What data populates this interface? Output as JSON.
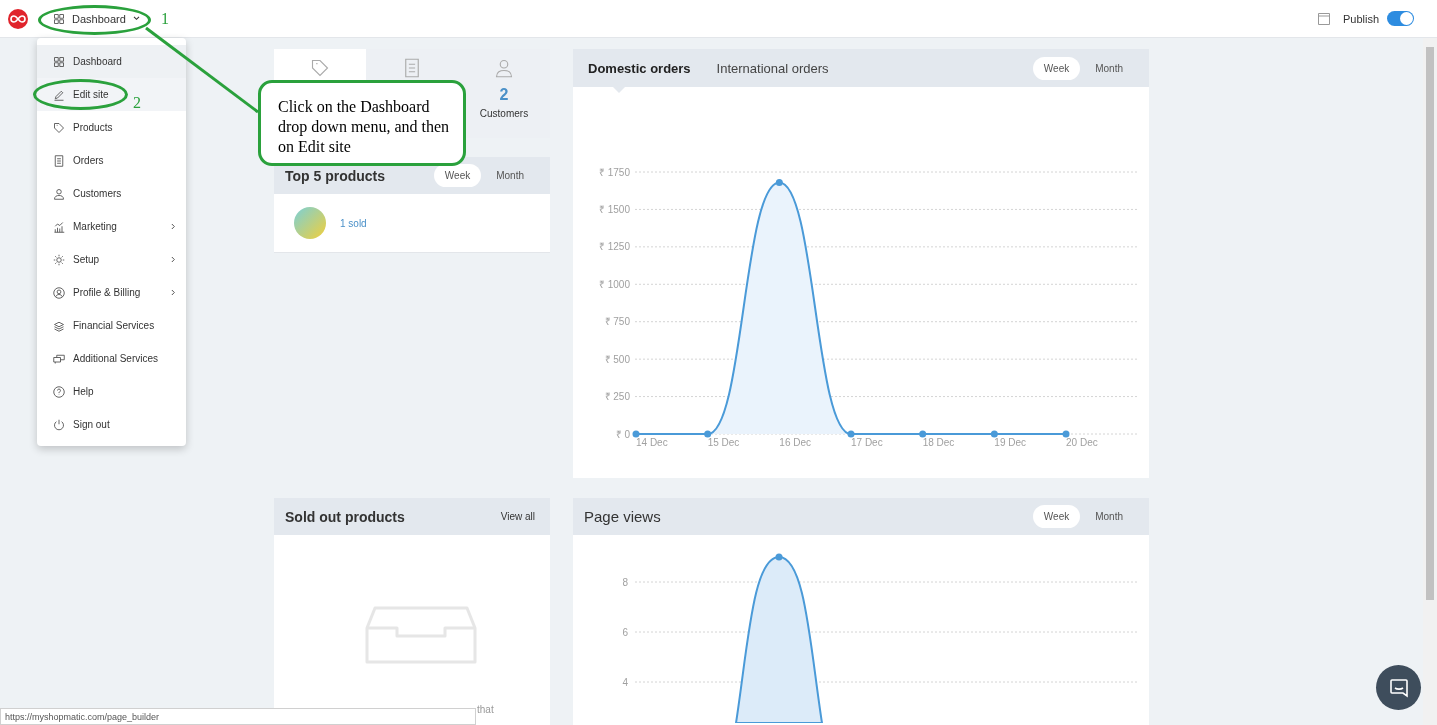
{
  "topbar": {
    "nav_button": {
      "label": "Dashboard",
      "expanded": true
    },
    "publish": {
      "label": "Publish",
      "on": true
    }
  },
  "menu": [
    {
      "label": "Dashboard",
      "kind": "grid",
      "selected": true,
      "hovered": false,
      "submenu": false
    },
    {
      "label": "Edit site",
      "kind": "pencil",
      "selected": false,
      "hovered": true,
      "submenu": false
    },
    {
      "label": "Products",
      "kind": "tag",
      "selected": false,
      "hovered": false,
      "submenu": false
    },
    {
      "label": "Orders",
      "kind": "document",
      "selected": false,
      "hovered": false,
      "submenu": false
    },
    {
      "label": "Customers",
      "kind": "person",
      "selected": false,
      "hovered": false,
      "submenu": false
    },
    {
      "label": "Marketing",
      "kind": "chart",
      "selected": false,
      "hovered": false,
      "submenu": true
    },
    {
      "label": "Setup",
      "kind": "gear",
      "selected": false,
      "hovered": false,
      "submenu": true
    },
    {
      "label": "Profile & Billing",
      "kind": "user-circle",
      "selected": false,
      "hovered": false,
      "submenu": true
    },
    {
      "label": "Financial Services",
      "kind": "stack",
      "selected": false,
      "hovered": false,
      "submenu": false
    },
    {
      "label": "Additional Services",
      "kind": "services",
      "selected": false,
      "hovered": false,
      "submenu": false
    },
    {
      "label": "Help",
      "kind": "question",
      "selected": false,
      "hovered": false,
      "submenu": false
    },
    {
      "label": "Sign out",
      "kind": "power",
      "selected": false,
      "hovered": false,
      "submenu": false
    }
  ],
  "stats": [
    {
      "kind": "tag",
      "selected": true
    },
    {
      "kind": "document",
      "selected": false
    },
    {
      "kind": "person",
      "selected": false,
      "value": "2",
      "label": "Customers"
    }
  ],
  "top_products": {
    "title": "Top 5 products",
    "periods": [
      {
        "label": "Week",
        "selected": true
      },
      {
        "label": "Month",
        "selected": false
      }
    ],
    "rows": [
      {
        "sold": "1 sold"
      }
    ]
  },
  "orders_chart": {
    "tabs": [
      {
        "label": "Domestic orders",
        "selected": true
      },
      {
        "label": "International orders",
        "selected": false
      }
    ],
    "periods": [
      {
        "label": "Week",
        "selected": true
      },
      {
        "label": "Month",
        "selected": false
      }
    ],
    "chart_data": {
      "type": "area",
      "categories": [
        "14 Dec",
        "15 Dec",
        "16 Dec",
        "17 Dec",
        "18 Dec",
        "19 Dec",
        "20 Dec"
      ],
      "series": [
        {
          "color": "#4a9ad8",
          "values": [
            0,
            0,
            1680,
            0,
            0,
            0,
            0
          ]
        }
      ],
      "grid": true,
      "ylim": [
        0,
        1750
      ],
      "yticks": [
        {
          "value": 0,
          "label": "₹ 0"
        },
        {
          "value": 250,
          "label": "₹ 250"
        },
        {
          "value": 500,
          "label": "₹ 500"
        },
        {
          "value": 750,
          "label": "₹ 750"
        },
        {
          "value": 1000,
          "label": "₹ 1000"
        },
        {
          "value": 1250,
          "label": "₹ 1250"
        },
        {
          "value": 1500,
          "label": "₹ 1500"
        },
        {
          "value": 1750,
          "label": "₹ 1750"
        }
      ]
    }
  },
  "sold_out": {
    "title": "Sold out products",
    "link": "View all",
    "message": "that"
  },
  "page_views": {
    "title": "Page views",
    "periods": [
      {
        "label": "Week",
        "selected": true
      },
      {
        "label": "Month",
        "selected": false
      }
    ],
    "axis_labels": [
      "8",
      "6",
      "4"
    ]
  },
  "status_url": "https://myshopmatic.com/page_builder",
  "annotations": {
    "steps": [
      "1",
      "2"
    ],
    "callout": "Click on the Dashboard drop down menu, and then on Edit site"
  }
}
